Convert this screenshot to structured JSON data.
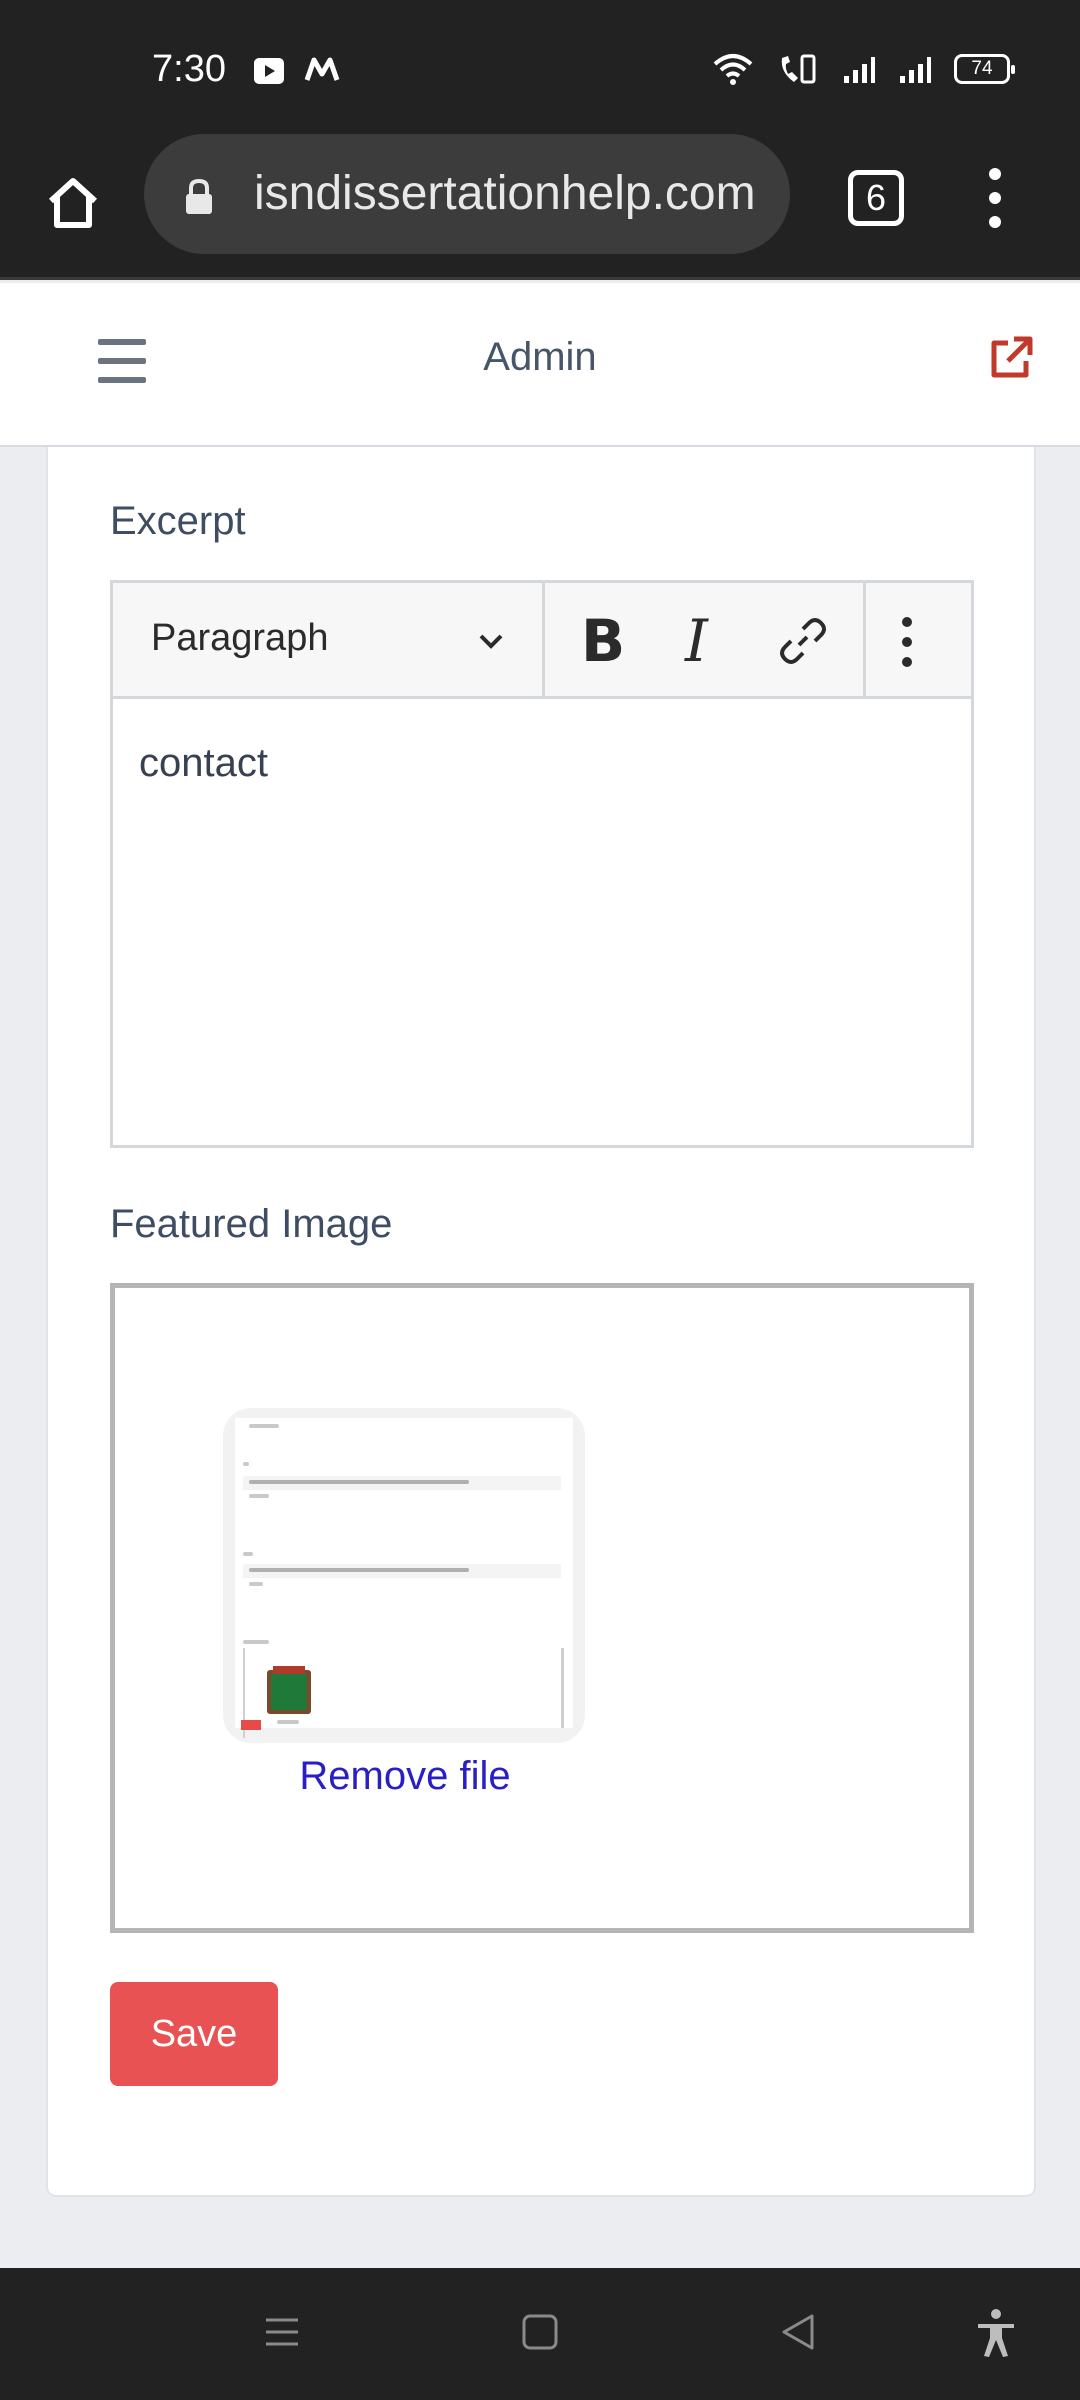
{
  "status_bar": {
    "time": "7:30",
    "battery": "74",
    "icons": [
      "media-app-icon",
      "m-app-icon",
      "wifi-icon",
      "vowifi-icon",
      "signal-icon",
      "signal-icon"
    ]
  },
  "browser": {
    "url": "isndissertationhelp.com",
    "tab_count": "6"
  },
  "header": {
    "title": "Admin"
  },
  "form": {
    "excerpt_label": "Excerpt",
    "editor": {
      "block_format": "Paragraph",
      "content": "contact"
    },
    "featured_image_label": "Featured Image",
    "remove_file_label": "Remove file",
    "save_label": "Save"
  },
  "colors": {
    "save_button": "#e85252",
    "link": "#2a1fc2",
    "external_icon": "#c0392b"
  }
}
